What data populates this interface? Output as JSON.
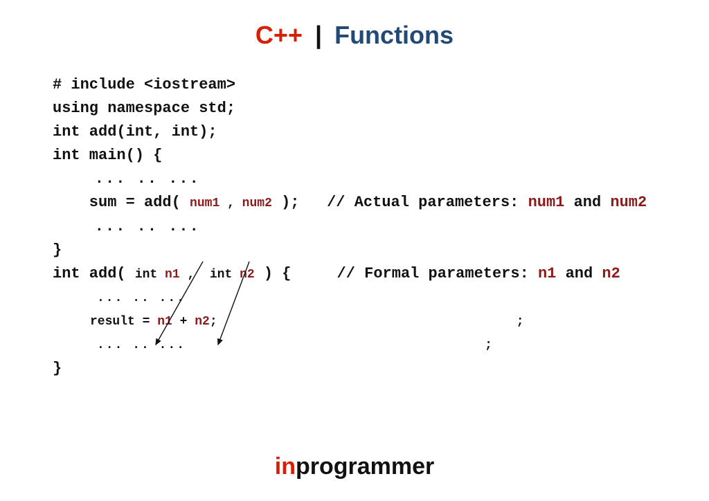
{
  "title": {
    "cpp": "C++",
    "pipe": "|",
    "sub": "Functions"
  },
  "code": {
    "l1": "# include <iostream>",
    "l2": "using namespace std;",
    "l3": "",
    "l4": "int add(int, int);",
    "l5": "",
    "l6": "int main() {",
    "l7": "    ... .. ...",
    "l8_a": "    sum = add( ",
    "l8_num1": "num1",
    "l8_comma": " , ",
    "l8_num2": "num2",
    "l8_b": " );   ",
    "l8_comment_a": "// Actual parameters: ",
    "l8_comment_n1": "num1",
    "l8_comment_and": " and ",
    "l8_comment_n2": "num2",
    "l9": "    ... .. ...",
    "l10": "}",
    "l11": "",
    "l12_a": "int add( ",
    "l12_int1": "int ",
    "l12_n1": "n1",
    "l12_c": " ,  ",
    "l12_int2": "int ",
    "l12_n2": "n2",
    "l12_b": " ) {     ",
    "l12_comment_a": "// Formal parameters: ",
    "l12_comment_n1": "n1",
    "l12_comment_and": " and ",
    "l12_comment_n2": "n2",
    "l13": "     ... .. ...",
    "l14_a": "     result = ",
    "l14_n1": "n1",
    "l14_plus": " + ",
    "l14_n2": "n2",
    "l14_semi": ";",
    "l14_pad": "                                        ",
    "l14_trail_semi": ";",
    "l15": "     ... .. ...",
    "l15_pad": "                                        ",
    "l15_trail_semi": ";",
    "l16": "}"
  },
  "footer": {
    "in": "in",
    "rest": "programmer"
  }
}
